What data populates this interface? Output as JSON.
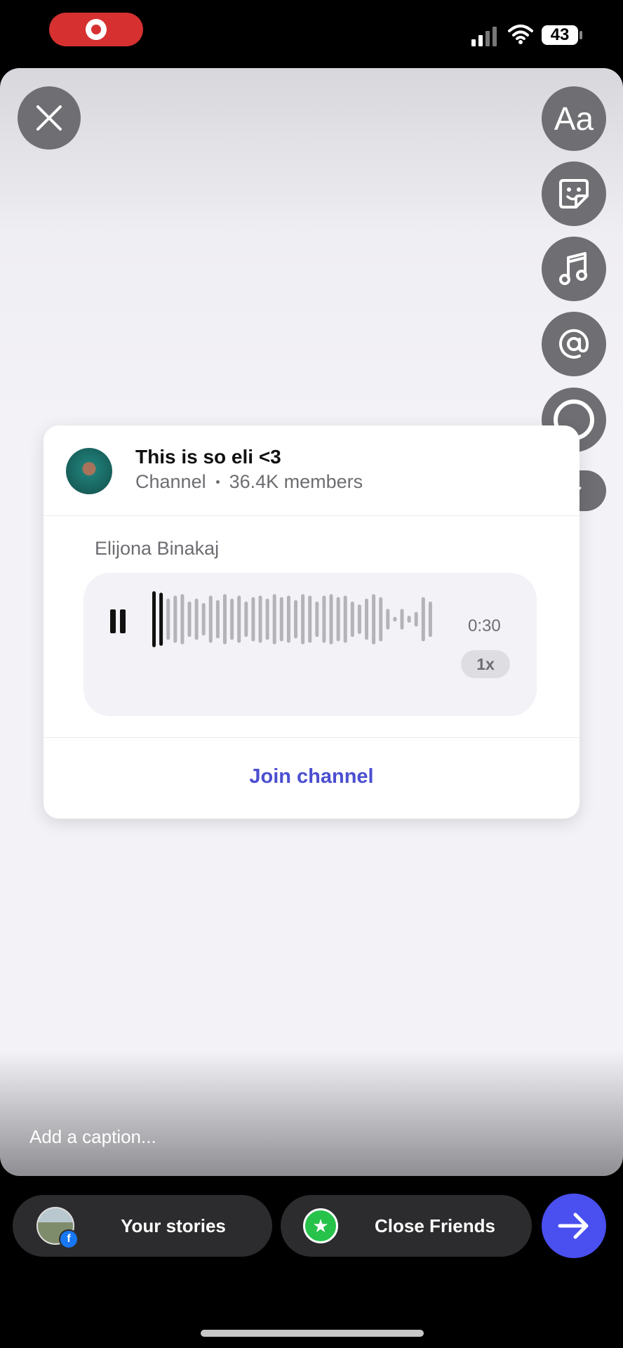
{
  "status_bar": {
    "battery": "43",
    "icons": [
      "screen-record-icon",
      "signal-icon",
      "wifi-icon",
      "battery-icon"
    ]
  },
  "editor": {
    "tools": [
      "close-icon",
      "text-icon",
      "sticker-icon",
      "music-icon",
      "mention-icon",
      "capture-icon",
      "chevron-down-icon"
    ],
    "text_tool_label": "Aa",
    "caption_placeholder": "Add a caption..."
  },
  "channel_card": {
    "title": "This is so eli <3",
    "type": "Channel",
    "members": "36.4K members",
    "sender": "Elijona Binakaj",
    "voice_message": {
      "duration": "0:30",
      "speed": "1x",
      "waveform": [
        0.95,
        0.9,
        0.7,
        0.8,
        0.85,
        0.6,
        0.7,
        0.55,
        0.8,
        0.65,
        0.85,
        0.7,
        0.8,
        0.6,
        0.75,
        0.8,
        0.7,
        0.85,
        0.75,
        0.8,
        0.65,
        0.85,
        0.8,
        0.6,
        0.8,
        0.85,
        0.75,
        0.8,
        0.6,
        0.5,
        0.7,
        0.85,
        0.75,
        0.35,
        0.08,
        0.35,
        0.12,
        0.25,
        0.75,
        0.6
      ]
    },
    "join_label": "Join channel",
    "colors": {
      "accent": "#4b4fd0",
      "played_bar": "#111111",
      "unplayed_bar": "#b4b4b8"
    }
  },
  "bottom_bar": {
    "your_stories": "Your stories",
    "close_friends": "Close Friends",
    "send_color": "#4a4ff0"
  }
}
